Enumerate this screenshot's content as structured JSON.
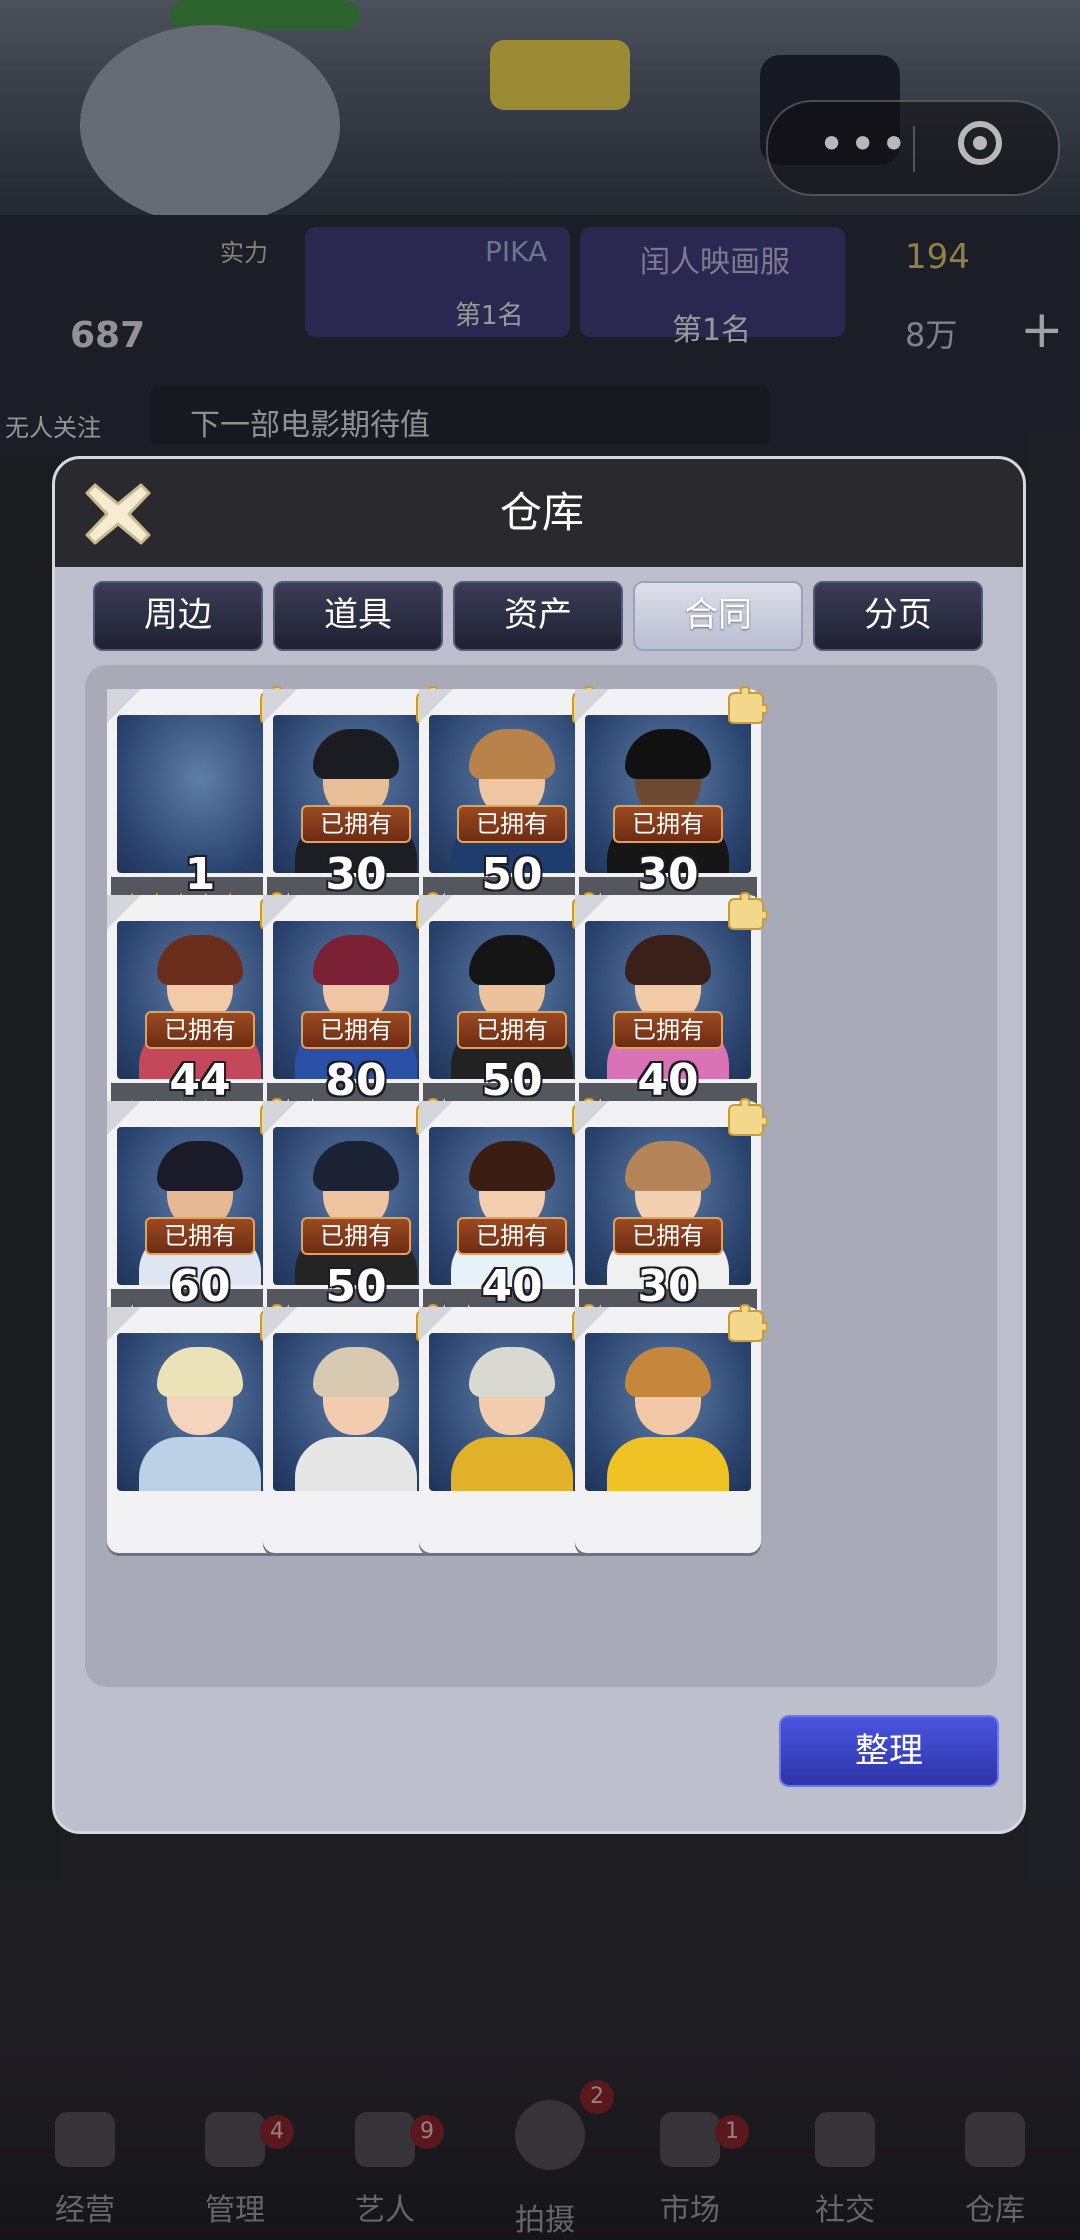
{
  "top_bar": {
    "more_icon": "ellipsis-icon",
    "close_icon": "target-circle-icon"
  },
  "hud": {
    "level": "687",
    "strength_label": "实力",
    "pika_label": "PIKA",
    "pika_rank": "第1名",
    "cinema_label": "闰人映画服",
    "cinema_rank": "第1名",
    "gold": "194",
    "gems": "8万",
    "no_follow": "无人关注",
    "next_movie": "下一部电影期待值"
  },
  "dialog": {
    "title": "仓库",
    "close_icon": "x-close-icon",
    "tabs": [
      {
        "label": "周边",
        "active": false
      },
      {
        "label": "道具",
        "active": false
      },
      {
        "label": "资产",
        "active": false
      },
      {
        "label": "合同",
        "active": true
      },
      {
        "label": "分页",
        "active": false
      }
    ],
    "owned_label": "已拥有",
    "cards": [
      {
        "count": "1",
        "owned": false,
        "stars": 5,
        "star_color": "gold"
      },
      {
        "count": "30",
        "owned": true,
        "stars": 1,
        "star_color": "white"
      },
      {
        "count": "50",
        "owned": true,
        "stars": 1,
        "star_color": "white"
      },
      {
        "count": "30",
        "owned": true,
        "stars": 1,
        "star_color": "white"
      },
      {
        "count": "44",
        "owned": true,
        "stars": 4,
        "star_color": "blue"
      },
      {
        "count": "80",
        "owned": true,
        "stars": 2,
        "star_color": "white"
      },
      {
        "count": "50",
        "owned": true,
        "stars": 1,
        "star_color": "white"
      },
      {
        "count": "40",
        "owned": true,
        "stars": 1,
        "star_color": "white"
      },
      {
        "count": "60",
        "owned": true,
        "stars": 1,
        "star_color": "white"
      },
      {
        "count": "50",
        "owned": true,
        "stars": 1,
        "star_color": "white"
      },
      {
        "count": "40",
        "owned": true,
        "stars": 2,
        "star_color": "white"
      },
      {
        "count": "30",
        "owned": true,
        "stars": 1,
        "star_color": "white"
      },
      {
        "count": "",
        "owned": false,
        "stars": 0,
        "star_color": "white"
      },
      {
        "count": "",
        "owned": false,
        "stars": 0,
        "star_color": "white"
      },
      {
        "count": "",
        "owned": false,
        "stars": 0,
        "star_color": "white"
      },
      {
        "count": "",
        "owned": false,
        "stars": 0,
        "star_color": "white"
      }
    ],
    "organize_label": "整理"
  },
  "bottom_nav": [
    {
      "label": "经营",
      "badge": "",
      "icon": "popcorn-icon"
    },
    {
      "label": "管理",
      "badge": "4",
      "icon": "manage-icon"
    },
    {
      "label": "艺人",
      "badge": "9",
      "icon": "artist-icon"
    },
    {
      "label": "拍摄",
      "badge": "2",
      "icon": "film-camera-icon"
    },
    {
      "label": "市场",
      "badge": "1",
      "icon": "market-icon"
    },
    {
      "label": "社交",
      "badge": "",
      "icon": "social-icon"
    },
    {
      "label": "仓库",
      "badge": "",
      "icon": "warehouse-icon"
    }
  ],
  "colors": {
    "dialog_bg": "#bdbfcc",
    "header_bg": "#2a2a2e",
    "tab_active": "#c9ccdb",
    "organize_button": "#3a44c8",
    "owned_badge": "#7e3618"
  }
}
